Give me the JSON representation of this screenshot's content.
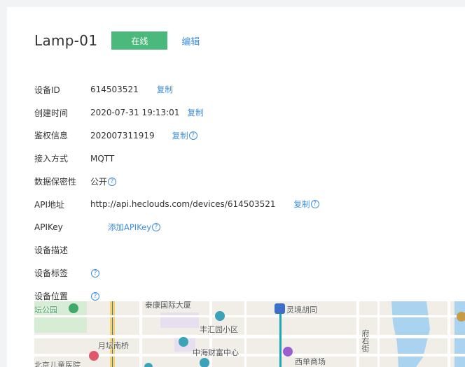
{
  "device": {
    "name": "Lamp-01",
    "status": "在线",
    "edit_label": "编辑"
  },
  "fields": {
    "device_id": {
      "label": "设备ID",
      "value": "614503521",
      "action": "复制"
    },
    "created_at": {
      "label": "创建时间",
      "value": "2020-07-31 19:13:01",
      "action": "复制"
    },
    "auth_info": {
      "label": "鉴权信息",
      "value": "202007311919",
      "action": "复制"
    },
    "protocol": {
      "label": "接入方式",
      "value": "MQTT"
    },
    "privacy": {
      "label": "数据保密性",
      "value": "公开"
    },
    "api_address": {
      "label": "API地址",
      "value": "http://api.heclouds.com/devices/614503521",
      "action": "复制"
    },
    "api_key": {
      "label": "APIKey",
      "action": "添加APIKey"
    },
    "description": {
      "label": "设备描述"
    },
    "tags": {
      "label": "设备标签"
    },
    "location": {
      "label": "设备位置"
    }
  },
  "help_glyph": "?",
  "map": {
    "labels": {
      "park": "坛公园",
      "building": "泰康国际大厦",
      "station": "灵境胡同",
      "community": "丰汇园小区",
      "bridge": "月坛南桥",
      "finance": "中海财富中心",
      "hospital": "北京儿童医院",
      "mall": "西单商场",
      "street": "府右街"
    }
  },
  "colors": {
    "accent": "#3d8fe0",
    "status_green": "#4cb97c",
    "background": "#f2f3f5",
    "map_road_yellow": "#f7d36b",
    "map_water": "#aad3f0",
    "metro_line": "#1aa6b7"
  }
}
